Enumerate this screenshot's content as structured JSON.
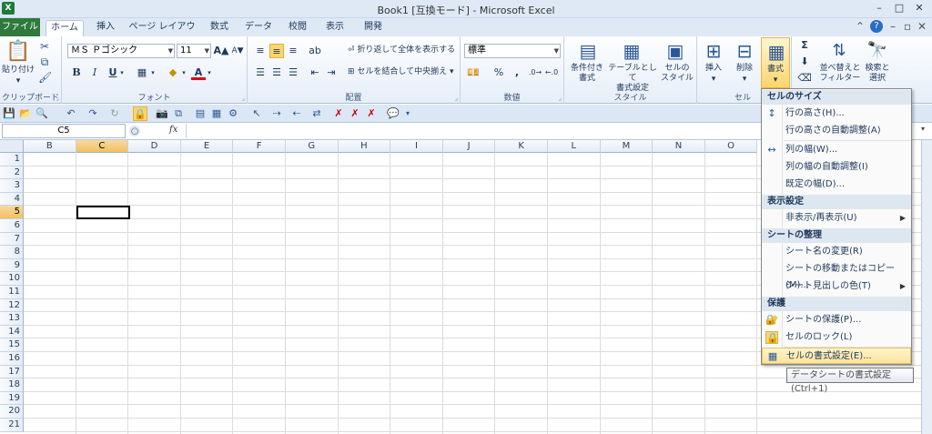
{
  "window": {
    "title": "Book1 [互換モード] - Microsoft Excel",
    "logo": "X",
    "min": "–",
    "max": "□",
    "close": "✕"
  },
  "tabs": {
    "file": "ファイル",
    "items": [
      "ホーム",
      "挿入",
      "ページ レイアウト",
      "数式",
      "データ",
      "校閲",
      "表示",
      "開発"
    ]
  },
  "tabright": {
    "help": "?",
    "min": "–",
    "restore": "▫",
    "close": "✕"
  },
  "ribbon": {
    "clipboard": {
      "label": "クリップボード",
      "paste": "貼り付け"
    },
    "font": {
      "label": "フォント",
      "font_name": "ＭＳ Ｐゴシック",
      "font_size": "11",
      "bold": "B",
      "italic": "I",
      "underline": "U",
      "grow": "A▲",
      "shrink": "A▼",
      "color": "A"
    },
    "align": {
      "label": "配置",
      "wrap": "折り返して全体を表示する",
      "merge": "セルを結合して中央揃え"
    },
    "number": {
      "label": "数値",
      "format": "標準",
      "percent": "%",
      "comma": ","
    },
    "styles": {
      "label": "スタイル",
      "conditional": "条件付き\n書式",
      "table": "テーブルとして\n書式設定",
      "cellstyle": "セルの\nスタイル"
    },
    "cells": {
      "label": "セル",
      "insert": "挿入",
      "delete": "削除",
      "format": "書式"
    },
    "editing": {
      "sum": "Σ",
      "sort": "並べ替えと\nフィルター",
      "find": "検索と\n選択"
    }
  },
  "formula": {
    "namebox": "C5",
    "fx": "fx"
  },
  "columns": [
    "B",
    "C",
    "D",
    "E",
    "F",
    "G",
    "H",
    "I",
    "J",
    "K",
    "L",
    "M",
    "N",
    "O"
  ],
  "rows": [
    "1",
    "2",
    "3",
    "4",
    "5",
    "6",
    "7",
    "8",
    "9",
    "10",
    "11",
    "12",
    "13",
    "14",
    "15",
    "16",
    "17",
    "18",
    "19",
    "20",
    "21"
  ],
  "menu": {
    "sec1": "セルのサイズ",
    "row_height": "行の高さ(H)...",
    "row_auto": "行の高さの自動調整(A)",
    "col_width": "列の幅(W)...",
    "col_auto": "列の幅の自動調整(I)",
    "default_width": "既定の幅(D)...",
    "sec2": "表示設定",
    "hide_show": "非表示/再表示(U)",
    "sec3": "シートの整理",
    "rename": "シート名の変更(R)",
    "move_copy": "シートの移動またはコピー(M)...",
    "tab_color": "シート見出しの色(T)",
    "sec4": "保護",
    "protect": "シートの保護(P)...",
    "lock": "セルのロック(L)",
    "format_cells": "セルの書式設定(E)..."
  },
  "tooltip": "データシートの書式設定 (Ctrl+1)"
}
